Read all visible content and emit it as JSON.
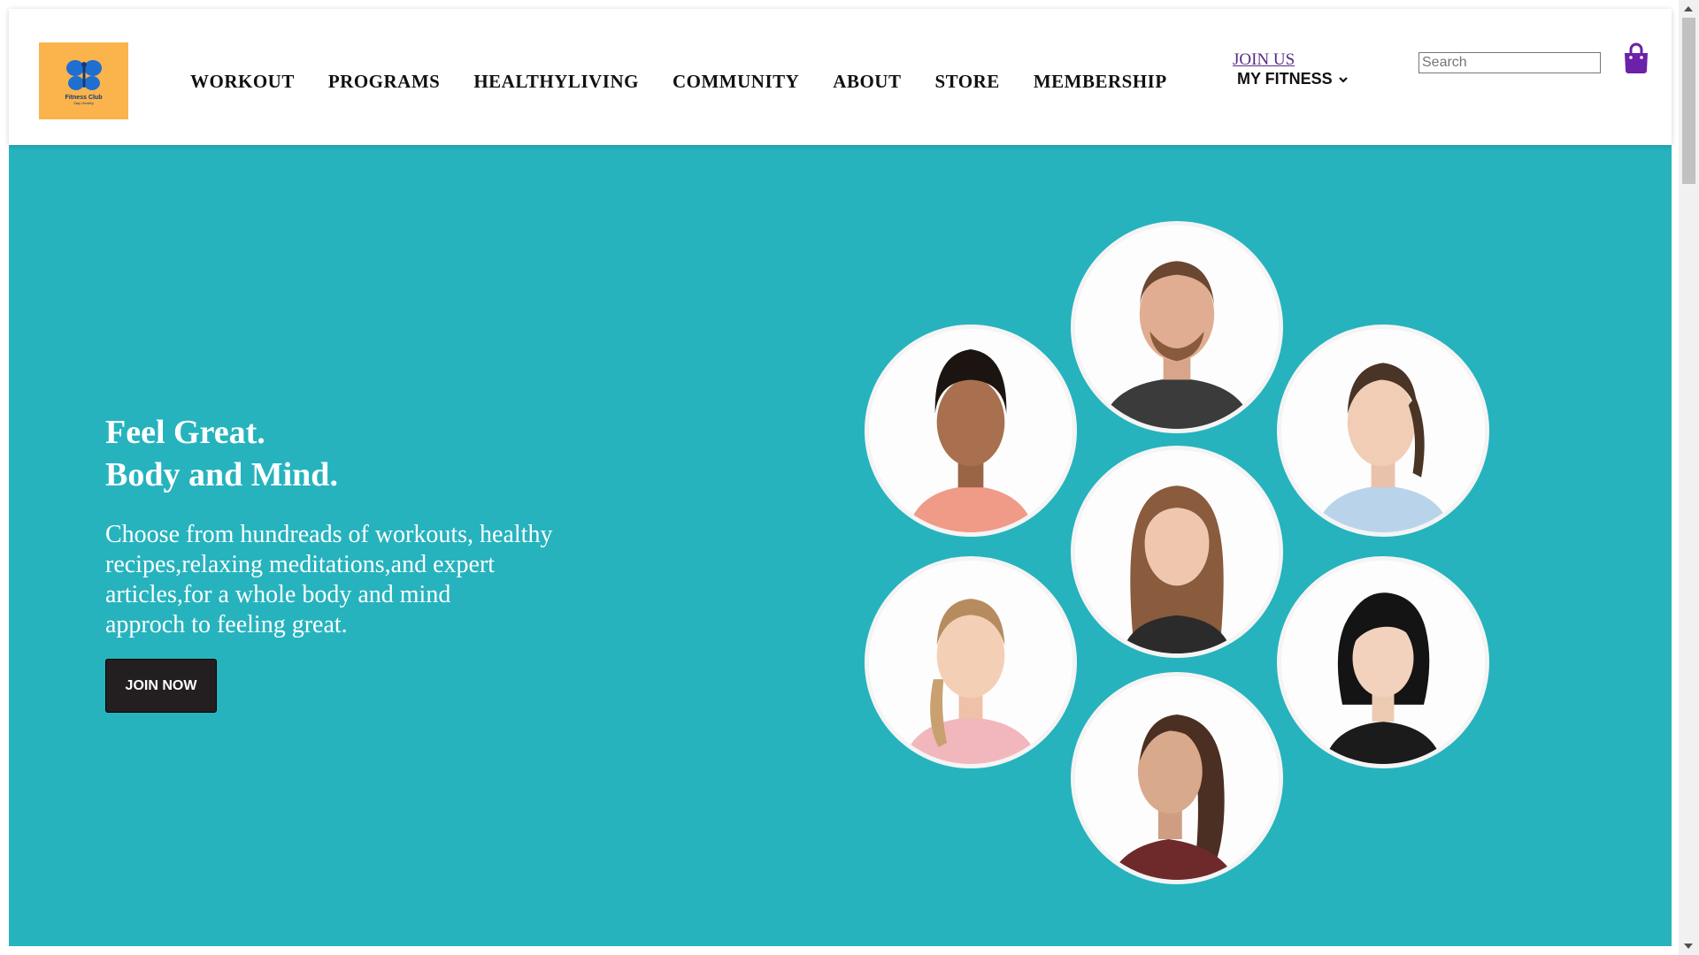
{
  "header": {
    "logo": {
      "name": "Fitness Club",
      "tagline": "Stay Healthy",
      "bg_color": "#fbb34c",
      "mark_color": "#1f6fd1"
    },
    "nav": [
      "WORKOUT",
      "PROGRAMS",
      "HEALTHYLIVING",
      "COMMUNITY",
      "ABOUT",
      "STORE",
      "MEMBERSHIP"
    ],
    "join_us": "JOIN US",
    "my_fitness": "MY FITNESS",
    "search": {
      "placeholder": "Search",
      "value": ""
    },
    "cart_icon": "shopping-bag-icon",
    "cart_color": "#6b21a8"
  },
  "hero": {
    "bg_color": "#26b3be",
    "title_line1": "Feel Great.",
    "title_line2": "Body and Mind.",
    "text_lines": [
      "Choose from hundreads of workouts, healthy",
      "recipes,relaxing meditations,and expert",
      "articles,for a whole body and mind",
      "approch to feeling great."
    ],
    "cta": "JOIN NOW",
    "instructors": [
      "instructor-avatar-1",
      "instructor-avatar-2",
      "instructor-avatar-3",
      "instructor-avatar-4",
      "instructor-avatar-5",
      "instructor-avatar-6",
      "instructor-avatar-7"
    ]
  }
}
